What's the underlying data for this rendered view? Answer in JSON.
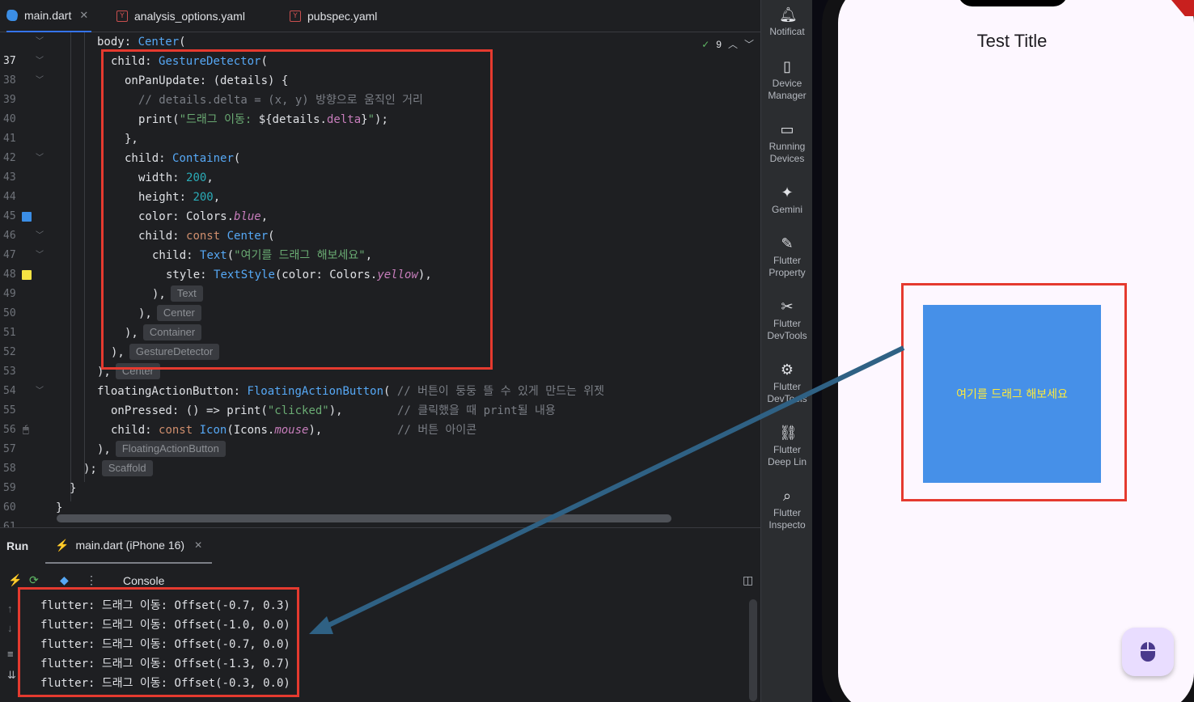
{
  "tabs": [
    {
      "label": "main.dart",
      "active": true,
      "icon": "dart-file-icon"
    },
    {
      "label": "analysis_options.yaml",
      "active": false,
      "icon": "yaml-file-icon"
    },
    {
      "label": "pubspec.yaml",
      "active": false,
      "icon": "yaml-file-icon"
    }
  ],
  "inspection": {
    "count": "9"
  },
  "editor": {
    "line_numbers": [
      "37",
      "38",
      "39",
      "40",
      "41",
      "42",
      "43",
      "44",
      "45",
      "46",
      "47",
      "48",
      "49",
      "50",
      "51",
      "52",
      "53",
      "54",
      "55",
      "56",
      "57",
      "58",
      "59",
      "60",
      "61"
    ],
    "code": {
      "l37": {
        "a": "body: ",
        "b": "Center",
        "c": "("
      },
      "l38": {
        "a": "child: ",
        "b": "GestureDetector",
        "c": "("
      },
      "l39": "onPanUpdate: (details) {",
      "l40": "// details.delta = (x, y) 방향으로 움직인 거리",
      "l41": {
        "a": "print(",
        "b": "\"드래그 이동: ",
        "c": "${details.",
        "d": "delta",
        "e": "}",
        "f": "\"",
        "g": ");"
      },
      "l42": "},",
      "l43": {
        "a": "child: ",
        "b": "Container",
        "c": "("
      },
      "l44": {
        "a": "width: ",
        "b": "200",
        "c": ","
      },
      "l45": {
        "a": "height: ",
        "b": "200",
        "c": ","
      },
      "l46": {
        "a": "color: Colors.",
        "b": "blue",
        "c": ","
      },
      "l47": {
        "a": "child: ",
        "b": "const ",
        "c": "Center",
        "d": "("
      },
      "l48": {
        "a": "child: ",
        "b": "Text",
        "c": "(",
        "d": "\"여기를 드래그 해보세요\"",
        "e": ","
      },
      "l49": {
        "a": "style: ",
        "b": "TextStyle",
        "c": "(color: Colors.",
        "d": "yellow",
        "e": "),"
      },
      "l50": "),",
      "l51": "),",
      "l52": "),",
      "l53": "),",
      "l54": "),",
      "l55": {
        "a": "floatingActionButton: ",
        "b": "FloatingActionButton",
        "c": "( ",
        "d": "// 버튼이 둥둥 뜰 수 있게 만드는 위젯"
      },
      "l56": {
        "a": "onPressed: () => print(",
        "b": "\"clicked\"",
        "c": "),        ",
        "d": "// 클릭했을 때 print될 내용"
      },
      "l57": {
        "a": "child: ",
        "b": "const ",
        "c": "Icon",
        "d": "(Icons.",
        "e": "mouse",
        "f": "),           ",
        "g": "// 버튼 아이콘"
      },
      "l58": "),",
      "l59": ");",
      "l60": "}",
      "l61": "}"
    },
    "hints": {
      "l50": "Text",
      "l51": "Center",
      "l52": "Container",
      "l53": "GestureDetector",
      "l54": "Center",
      "l58": "FloatingActionButton",
      "l59": "Scaffold"
    },
    "gutter_colors": {
      "blue": "#3b8ee6",
      "yellow": "#f5e343"
    }
  },
  "run_panel": {
    "title": "Run",
    "config_tab": "main.dart (iPhone 16)",
    "console_label": "Console",
    "console_lines": [
      "flutter: 드래그 이동: Offset(-0.7, 0.3)",
      "flutter: 드래그 이동: Offset(-1.0, 0.0)",
      "flutter: 드래그 이동: Offset(-0.7, 0.0)",
      "flutter: 드래그 이동: Offset(-1.3, 0.7)",
      "flutter: 드래그 이동: Offset(-0.3, 0.0)"
    ]
  },
  "tool_windows": [
    {
      "line1": "Notificat",
      "line2": "",
      "icon": "bell-icon"
    },
    {
      "line1": "Device",
      "line2": "Manager",
      "icon": "device-manager-icon"
    },
    {
      "line1": "Running",
      "line2": "Devices",
      "icon": "running-devices-icon"
    },
    {
      "line1": "Gemini",
      "line2": "",
      "icon": "gemini-sparkle-icon"
    },
    {
      "line1": "Flutter",
      "line2": "Property",
      "icon": "pencil-icon"
    },
    {
      "line1": "Flutter",
      "line2": "DevTools",
      "icon": "devtools-icon"
    },
    {
      "line1": "Flutter",
      "line2": "DevTools",
      "icon": "devtools-extension-icon"
    },
    {
      "line1": "Flutter",
      "line2": "Deep Lin",
      "icon": "link-icon"
    },
    {
      "line1": "Flutter",
      "line2": "Inspecto",
      "icon": "inspector-icon"
    }
  ],
  "device": {
    "app_title": "Test Title",
    "drag_box_text": "여기를 드래그 해보세요",
    "box_color": "#4690e8",
    "text_color": "#ffeb3b",
    "fab_icon": "mouse-icon"
  },
  "colors": {
    "highlight_border": "#e53a2f",
    "arrow": "#2f6184"
  }
}
